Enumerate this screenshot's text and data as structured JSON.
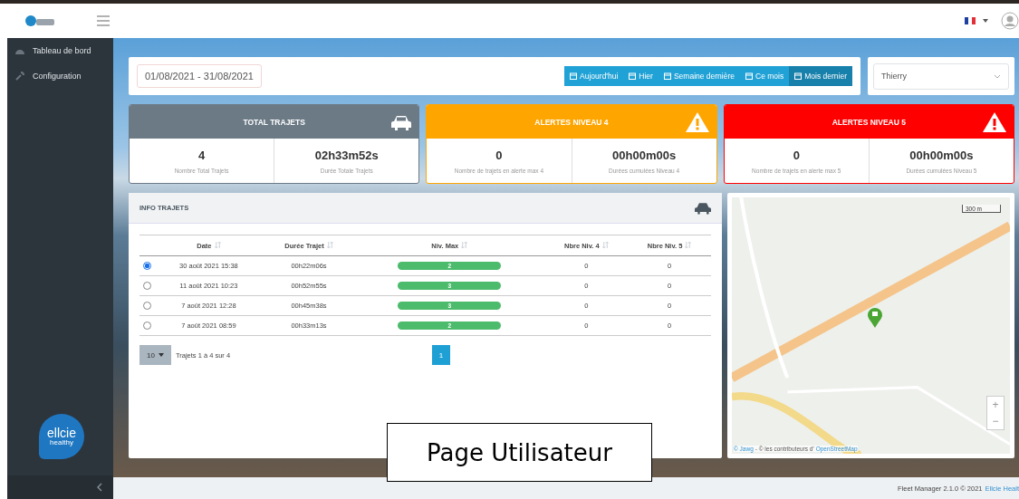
{
  "sidebar": {
    "items": [
      {
        "label": "Tableau de bord",
        "kind": "dashboard"
      },
      {
        "label": "Configuration",
        "kind": "config"
      }
    ],
    "brand": {
      "line_1": "ellcie",
      "line_2": "healthy"
    }
  },
  "date_range": {
    "value": "01/08/2021 - 31/08/2021"
  },
  "range_buttons": [
    {
      "label": "Aujourd'hui",
      "selected": false
    },
    {
      "label": "Hier",
      "selected": false
    },
    {
      "label": "Semaine dernière",
      "selected": false
    },
    {
      "label": "Ce mois",
      "selected": false
    },
    {
      "label": "Mois dernier",
      "selected": true
    }
  ],
  "user_select": {
    "value": "Thierry"
  },
  "stat_cards": [
    {
      "kind": "total",
      "title": "TOTAL TRAJETS",
      "color": "#6c7a86",
      "stats": [
        {
          "value": "4",
          "label": "Nombre Total Trajets"
        },
        {
          "value": "02h33m52s",
          "label": "Durée Totale Trajets"
        }
      ]
    },
    {
      "kind": "alert",
      "title": "ALERTES NIVEAU 4",
      "color": "#ffa500",
      "stats": [
        {
          "value": "0",
          "label": "Nombre de trajets en alerte max 4"
        },
        {
          "value": "00h00m00s",
          "label": "Durées cumulées Niveau 4"
        }
      ]
    },
    {
      "kind": "alert",
      "title": "ALERTES NIVEAU 5",
      "color": "#ff0000",
      "stats": [
        {
          "value": "0",
          "label": "Nombre de trajets en alerte max 5"
        },
        {
          "value": "00h00m00s",
          "label": "Durées cumulées Niveau 5"
        }
      ]
    }
  ],
  "trips": {
    "title": "INFO TRAJETS",
    "columns": [
      "Date",
      "Durée Trajet",
      "Niv. Max",
      "Nbre Niv. 4",
      "Nbre Niv. 5"
    ],
    "rows": [
      {
        "selected": true,
        "date": "30 août 2021 15:38",
        "duration": "00h22m06s",
        "max_level": "2",
        "count_4": "0",
        "count_5": "0"
      },
      {
        "selected": false,
        "date": "11 août 2021 10:23",
        "duration": "00h52m55s",
        "max_level": "3",
        "count_4": "0",
        "count_5": "0"
      },
      {
        "selected": false,
        "date": "7 août 2021 12:28",
        "duration": "00h45m38s",
        "max_level": "3",
        "count_4": "0",
        "count_5": "0"
      },
      {
        "selected": false,
        "date": "7 août 2021 08:59",
        "duration": "00h33m13s",
        "max_level": "2",
        "count_4": "0",
        "count_5": "0"
      }
    ],
    "page_size": "10",
    "info": "Trajets 1 à 4 sur 4",
    "pages": [
      {
        "label": "1",
        "selected": true
      }
    ]
  },
  "map": {
    "scale": "300 m",
    "zoom_in": "+",
    "zoom_out": "−",
    "attribution_link_1": "© Jawg",
    "attribution_text": "- © les contributeurs d'",
    "attribution_link_2": "OpenStreetMap"
  },
  "caption": "Page Utilisateur",
  "footer": {
    "text": "Fleet Manager 2.1.0 © 2021",
    "link": "Ellcie Healt"
  }
}
